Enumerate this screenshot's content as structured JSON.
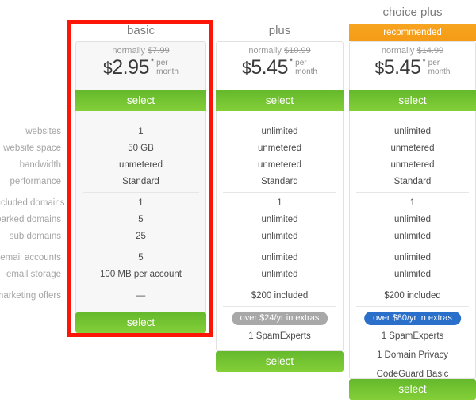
{
  "feature_labels": [
    "websites",
    "website space",
    "bandwidth",
    "performance",
    "included domains",
    "parked domains",
    "sub domains",
    "email accounts",
    "email storage",
    "marketing offers"
  ],
  "select_label": "select",
  "plans": [
    {
      "name": "basic",
      "recommended_badge": null,
      "normally_prefix": "normally",
      "normally_price": "$7.99",
      "currency": "$",
      "price": "2.95",
      "asterisk": "*",
      "per_line1": "per",
      "per_line2": "month",
      "features": [
        "1",
        "50 GB",
        "unmetered",
        "Standard",
        "1",
        "5",
        "25",
        "5",
        "100 MB per account",
        "—"
      ],
      "extras_pill": null,
      "bonus_items": [],
      "highlighted": true
    },
    {
      "name": "plus",
      "recommended_badge": null,
      "normally_prefix": "normally",
      "normally_price": "$10.99",
      "currency": "$",
      "price": "5.45",
      "asterisk": "*",
      "per_line1": "per",
      "per_line2": "month",
      "features": [
        "unlimited",
        "unmetered",
        "unmetered",
        "Standard",
        "1",
        "unlimited",
        "unlimited",
        "unlimited",
        "unlimited",
        "$200 included"
      ],
      "extras_pill": {
        "text": "over $24/yr in extras",
        "color": "#a8a8a8",
        "style": "grey"
      },
      "bonus_items": [
        "1 SpamExperts"
      ],
      "highlighted": false
    },
    {
      "name": "choice plus",
      "recommended_badge": "recommended",
      "normally_prefix": "normally",
      "normally_price": "$14.99",
      "currency": "$",
      "price": "5.45",
      "asterisk": "*",
      "per_line1": "per",
      "per_line2": "month",
      "features": [
        "unlimited",
        "unmetered",
        "unmetered",
        "Standard",
        "1",
        "unlimited",
        "unlimited",
        "unlimited",
        "unlimited",
        "$200 included"
      ],
      "extras_pill": {
        "text": "over $80/yr in extras",
        "color": "#2a6fc9",
        "style": "blue"
      },
      "bonus_items": [
        "1 SpamExperts",
        "1 Domain Privacy",
        "CodeGuard Basic"
      ],
      "highlighted": false
    }
  ],
  "colors": {
    "select_green": "#6fc230",
    "recommended_orange": "#f7a521",
    "highlight_red": "#fb1608",
    "extras_grey": "#a8a8a8",
    "extras_blue": "#2a6fc9"
  }
}
